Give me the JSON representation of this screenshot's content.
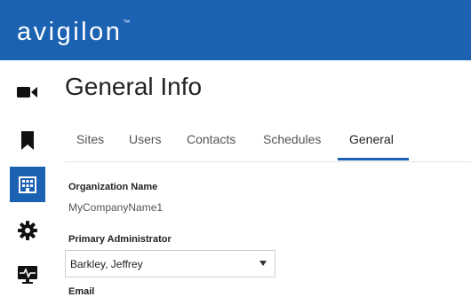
{
  "brand": {
    "logo_text": "avigilon",
    "trademark": "™",
    "color": "#1b62b3"
  },
  "sidebar": {
    "items": [
      {
        "name": "camera",
        "icon": "video-camera-icon",
        "active": false
      },
      {
        "name": "bookmarks",
        "icon": "bookmark-icon",
        "active": false
      },
      {
        "name": "organization",
        "icon": "building-icon",
        "active": true
      },
      {
        "name": "settings",
        "icon": "gear-icon",
        "active": false
      },
      {
        "name": "health",
        "icon": "monitor-pulse-icon",
        "active": false
      }
    ]
  },
  "page": {
    "title": "General Info"
  },
  "tabs": [
    {
      "label": "Sites",
      "active": false
    },
    {
      "label": "Users",
      "active": false
    },
    {
      "label": "Contacts",
      "active": false
    },
    {
      "label": "Schedules",
      "active": false
    },
    {
      "label": "General",
      "active": true
    }
  ],
  "form": {
    "organization_name": {
      "label": "Organization Name",
      "value": "MyCompanyName1"
    },
    "primary_admin": {
      "label": "Primary Administrator",
      "value": "Barkley, Jeffrey"
    },
    "email": {
      "label": "Email"
    }
  }
}
